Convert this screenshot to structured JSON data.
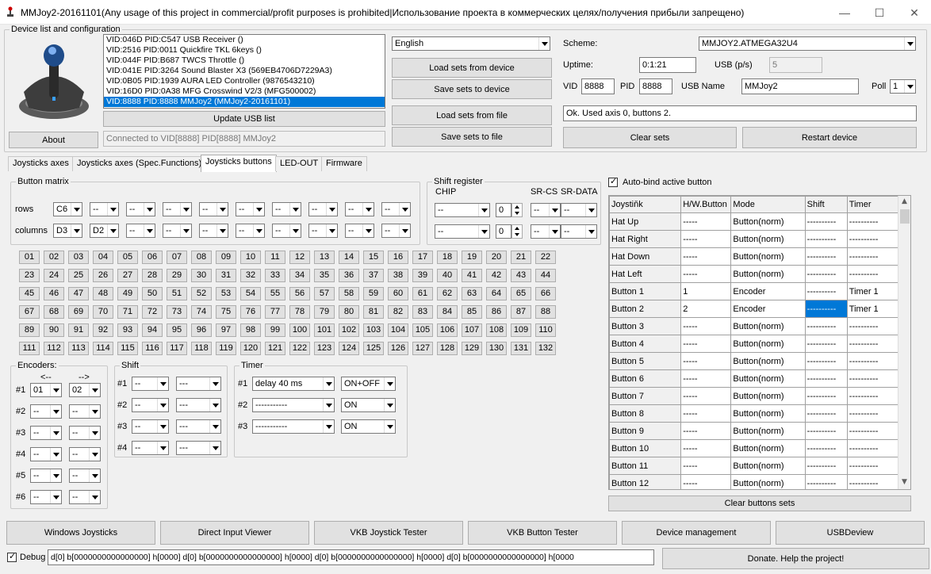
{
  "window": {
    "title": "MMJoy2-20161101(Any usage of this project in commercial/profit purposes is prohibited|Использование проекта в коммерческих целях/получения прибыли запрещено)"
  },
  "device_group": {
    "label": "Device list and configuration",
    "usb_list": [
      "VID:046D PID:C547 USB Receiver ()",
      "VID:2516 PID:0011 Quickfire TKL 6keys ()",
      "VID:044F PID:B687 TWCS Throttle ()",
      "VID:041E PID:3264 Sound Blaster X3 (569EB4706D7229A3)",
      "VID:0B05 PID:1939 AURA LED Controller (9876543210)",
      "VID:16D0 PID:0A38 MFG Crosswind V2/3 (MFG500002)",
      "VID:8888 PID:8888 MMJoy2 (MMJoy2-20161101)"
    ],
    "update_usb": "Update USB list",
    "about": "About",
    "connected": "Connected to VID[8888] PID[8888] MMJoy2",
    "language": "English",
    "load_device": "Load sets from device",
    "save_device": "Save sets to device",
    "load_file": "Load sets from file",
    "save_file": "Save sets to file",
    "scheme_label": "Scheme:",
    "scheme": "MMJOY2.ATMEGA32U4",
    "uptime_label": "Uptime:",
    "uptime": "0:1:21",
    "usb_ps_label": "USB (p/s)",
    "usb_ps": "5",
    "vid_label": "VID",
    "vid": "8888",
    "pid_label": "PID",
    "pid": "8888",
    "usbname_label": "USB Name",
    "usbname": "MMJoy2",
    "poll_label": "Poll",
    "poll": "1",
    "status": "Ok. Used axis  0, buttons 2.",
    "clear_sets": "Clear sets",
    "restart": "Restart device"
  },
  "tabs": [
    "Joysticks axes",
    "Joysticks axes (Spec.Functions)",
    "Joysticks buttons",
    "LED-OUT",
    "Firmware"
  ],
  "matrix": {
    "label": "Button matrix",
    "rows_label": "rows",
    "cols_label": "columns",
    "rows": [
      "C6",
      "--",
      "--",
      "--",
      "--",
      "--",
      "--",
      "--",
      "--",
      "--"
    ],
    "cols": [
      "D3",
      "D2",
      "--",
      "--",
      "--",
      "--",
      "--",
      "--",
      "--",
      "--"
    ]
  },
  "shiftreg": {
    "label": "Shift register",
    "chip": "CHIP",
    "srcs": "SR-CS",
    "srdata": "SR-DATA",
    "chips": [
      "--",
      "--"
    ],
    "counts": [
      "0",
      "0"
    ],
    "cs": [
      "--",
      "--"
    ],
    "data": [
      "--",
      "--"
    ]
  },
  "buttons": [
    "01",
    "02",
    "03",
    "04",
    "05",
    "06",
    "07",
    "08",
    "09",
    "10",
    "11",
    "12",
    "13",
    "14",
    "15",
    "16",
    "17",
    "18",
    "19",
    "20",
    "21",
    "22",
    "23",
    "24",
    "25",
    "26",
    "27",
    "28",
    "29",
    "30",
    "31",
    "32",
    "33",
    "34",
    "35",
    "36",
    "37",
    "38",
    "39",
    "40",
    "41",
    "42",
    "43",
    "44",
    "45",
    "46",
    "47",
    "48",
    "49",
    "50",
    "51",
    "52",
    "53",
    "54",
    "55",
    "56",
    "57",
    "58",
    "59",
    "60",
    "61",
    "62",
    "63",
    "64",
    "65",
    "66",
    "67",
    "68",
    "69",
    "70",
    "71",
    "72",
    "73",
    "74",
    "75",
    "76",
    "77",
    "78",
    "79",
    "80",
    "81",
    "82",
    "83",
    "84",
    "85",
    "86",
    "87",
    "88",
    "89",
    "90",
    "91",
    "92",
    "93",
    "94",
    "95",
    "96",
    "97",
    "98",
    "99",
    "100",
    "101",
    "102",
    "103",
    "104",
    "105",
    "106",
    "107",
    "108",
    "109",
    "110",
    "111",
    "112",
    "113",
    "114",
    "115",
    "116",
    "117",
    "118",
    "119",
    "120",
    "121",
    "122",
    "123",
    "124",
    "125",
    "126",
    "127",
    "128",
    "129",
    "130",
    "131",
    "132"
  ],
  "encoders": {
    "label": "Encoders:",
    "left_arrow": "<--",
    "right_arrow": "-->",
    "rows": [
      {
        "n": "#1",
        "a": "01",
        "b": "02"
      },
      {
        "n": "#2",
        "a": "--",
        "b": "--"
      },
      {
        "n": "#3",
        "a": "--",
        "b": "--"
      },
      {
        "n": "#4",
        "a": "--",
        "b": "--"
      },
      {
        "n": "#5",
        "a": "--",
        "b": "--"
      },
      {
        "n": "#6",
        "a": "--",
        "b": "--"
      }
    ]
  },
  "shift": {
    "label": "Shift",
    "rows": [
      {
        "n": "#1",
        "a": "--",
        "b": "---"
      },
      {
        "n": "#2",
        "a": "--",
        "b": "---"
      },
      {
        "n": "#3",
        "a": "--",
        "b": "---"
      },
      {
        "n": "#4",
        "a": "--",
        "b": "---"
      }
    ]
  },
  "timer": {
    "label": "Timer",
    "rows": [
      {
        "n": "#1",
        "a": "delay 40 ms",
        "b": "ON+OFF"
      },
      {
        "n": "#2",
        "a": "-----------",
        "b": "ON"
      },
      {
        "n": "#3",
        "a": "-----------",
        "b": "ON"
      }
    ]
  },
  "autobind": "Auto-bind active button",
  "grid": {
    "headers": [
      "Joystiňk",
      "H/W.Button",
      "Mode",
      "Shift",
      "Timer"
    ],
    "rows": [
      [
        "Hat Up",
        "-----",
        "Button(norm)",
        "----------",
        "----------"
      ],
      [
        "Hat Right",
        "-----",
        "Button(norm)",
        "----------",
        "----------"
      ],
      [
        "Hat Down",
        "-----",
        "Button(norm)",
        "----------",
        "----------"
      ],
      [
        "Hat Left",
        "-----",
        "Button(norm)",
        "----------",
        "----------"
      ],
      [
        "Button 1",
        "1",
        "Encoder",
        "----------",
        "Timer 1"
      ],
      [
        "Button 2",
        "2",
        "Encoder",
        "----------",
        "Timer 1"
      ],
      [
        "Button 3",
        "-----",
        "Button(norm)",
        "----------",
        "----------"
      ],
      [
        "Button 4",
        "-----",
        "Button(norm)",
        "----------",
        "----------"
      ],
      [
        "Button 5",
        "-----",
        "Button(norm)",
        "----------",
        "----------"
      ],
      [
        "Button 6",
        "-----",
        "Button(norm)",
        "----------",
        "----------"
      ],
      [
        "Button 7",
        "-----",
        "Button(norm)",
        "----------",
        "----------"
      ],
      [
        "Button 8",
        "-----",
        "Button(norm)",
        "----------",
        "----------"
      ],
      [
        "Button 9",
        "-----",
        "Button(norm)",
        "----------",
        "----------"
      ],
      [
        "Button 10",
        "-----",
        "Button(norm)",
        "----------",
        "----------"
      ],
      [
        "Button 11",
        "-----",
        "Button(norm)",
        "----------",
        "----------"
      ],
      [
        "Button 12",
        "-----",
        "Button(norm)",
        "----------",
        "----------"
      ]
    ]
  },
  "clear_buttons": "Clear buttons sets",
  "bottom_buttons": [
    "Windows Joysticks",
    "Direct Input Viewer",
    "VKB Joystick Tester",
    "VKB Button Tester",
    "Device management",
    "USBDeview"
  ],
  "debug_label": "Debug",
  "debug_text": "d[0] b[0000000000000000] h[0000]   d[0] b[0000000000000000] h[0000]   d[0] b[0000000000000000] h[0000]   d[0] b[0000000000000000] h[0000",
  "donate": "Donate. Help the project!"
}
